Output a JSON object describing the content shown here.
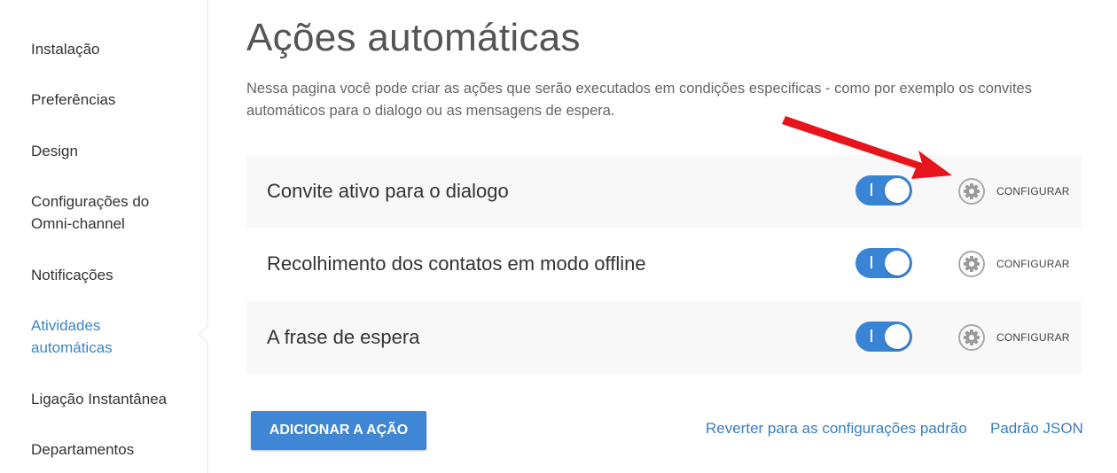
{
  "sidebar": {
    "items": [
      {
        "label": "Instalação"
      },
      {
        "label": "Preferências"
      },
      {
        "label": "Design"
      },
      {
        "label": "Configurações do Omni-channel"
      },
      {
        "label": "Notificações"
      },
      {
        "label": "Atividades automáticas"
      },
      {
        "label": "Ligação Instantânea"
      },
      {
        "label": "Departamentos"
      }
    ],
    "active_item": "Atividades automáticas"
  },
  "main": {
    "title": "Ações automáticas",
    "description": "Nessa pagina você pode criar as ações que serão executados em condições especificas - como por exemplo os convites automáticos para o dialogo ou as mensagens de espera.",
    "actions": [
      {
        "label": "Convite ativo para o dialogo",
        "enabled": true,
        "toggle_mark": "I",
        "config_label": "CONFIGURAR"
      },
      {
        "label": "Recolhimento dos contatos em modo offline",
        "enabled": true,
        "toggle_mark": "I",
        "config_label": "CONFIGURAR"
      },
      {
        "label": "A frase de espera",
        "enabled": true,
        "toggle_mark": "I",
        "config_label": "CONFIGURAR"
      }
    ],
    "add_button_label": "ADICIONAR A AÇÃO",
    "reset_link_label": "Reverter para as configurações padrão",
    "json_link_label": "Padrão JSON"
  },
  "colors": {
    "accent": "#3a84d6",
    "link": "#3a7fc0",
    "active_sidebar": "#3a86c8",
    "row_shade": "#f8f8f8",
    "annotation_arrow": "#e8141b"
  },
  "icons": {
    "config": "gear-icon",
    "annotation": "red-arrow-annotation"
  }
}
